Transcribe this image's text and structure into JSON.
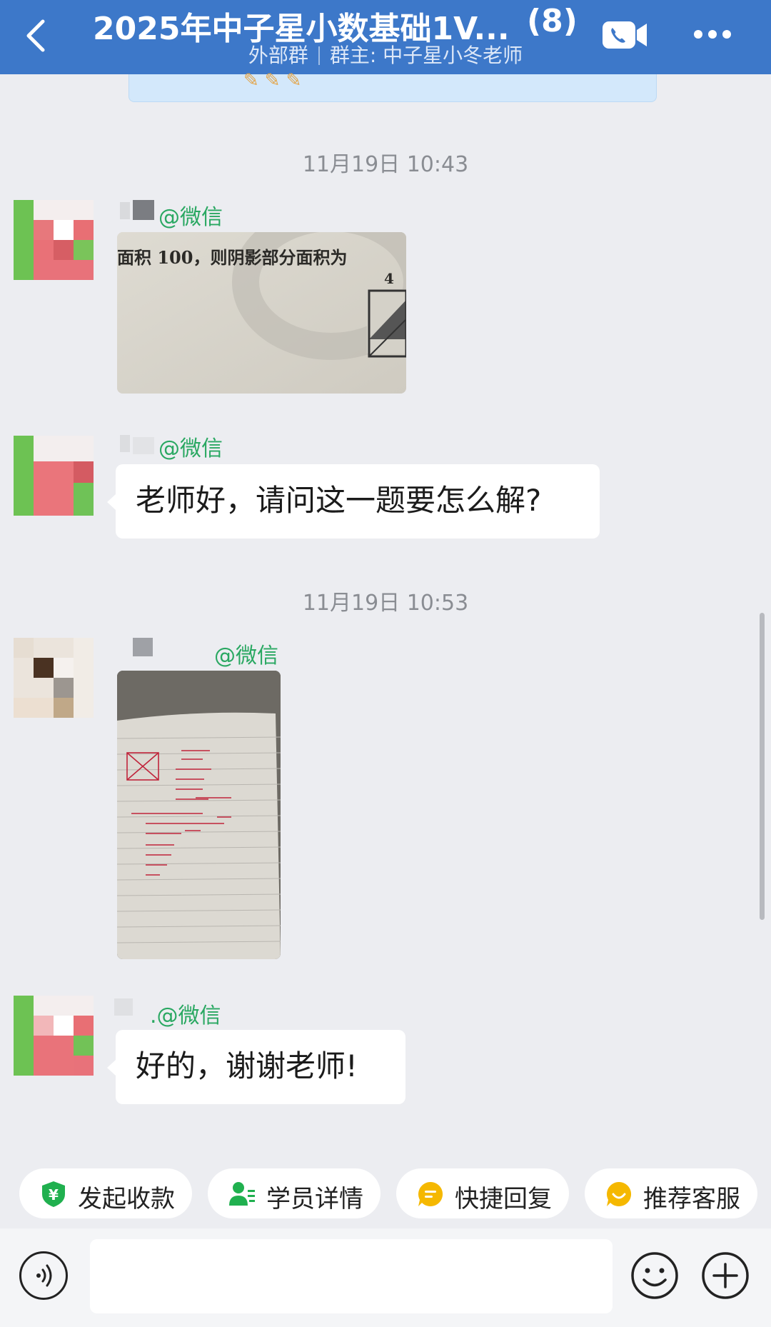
{
  "header": {
    "title": "2025年中子星小数基础1V...",
    "member_count": "(8)",
    "group_type": "外部群",
    "owner": "群主: 中子星小冬老师"
  },
  "messages": {
    "time1": "11月19日 10:43",
    "time2": "11月19日 10:53",
    "m1_sender": "@微信",
    "m1_image_text": "面积 100，则阴影部分面积为",
    "m1_image_num": "4",
    "m2_sender": "@微信",
    "m2_text": "老师好，请问这一题要怎么解?",
    "m3_sender": "@微信",
    "m4_sender": ".@微信",
    "m4_text": "好的，谢谢老师!"
  },
  "quick_actions": [
    {
      "label": "发起收款",
      "icon": "payment-shield-icon",
      "color": "#20b04f"
    },
    {
      "label": "学员详情",
      "icon": "student-profile-icon",
      "color": "#20b04f"
    },
    {
      "label": "快捷回复",
      "icon": "quick-reply-icon",
      "color": "#f5b800"
    },
    {
      "label": "推荐客服",
      "icon": "recommend-service-icon",
      "color": "#f5b800"
    }
  ],
  "colors": {
    "header_bg": "#3d78c9",
    "sender_name": "#2aa862",
    "chat_bg": "#ecedf1"
  }
}
